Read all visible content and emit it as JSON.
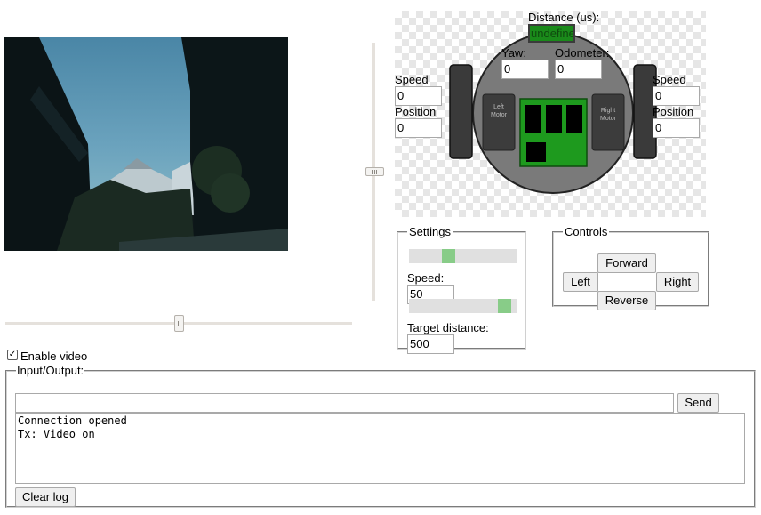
{
  "robot": {
    "distance_label": "Distance (us):",
    "distance_value": "undefine",
    "yaw_label": "Yaw:",
    "yaw_value": "0",
    "odometer_label": "Odometer:",
    "odometer_value": "0",
    "left_speed_label": "Speed",
    "left_speed_value": "0",
    "left_position_label": "Position",
    "left_position_value": "0",
    "right_speed_label": "Speed",
    "right_speed_value": "0",
    "right_position_label": "Position",
    "right_position_value": "0",
    "left_motor_label_line1": "Left",
    "left_motor_label_line2": "Motor",
    "right_motor_label_line1": "Right",
    "right_motor_label_line2": "Motor"
  },
  "settings": {
    "legend": "Settings",
    "speed_label": "Speed:",
    "speed_value": "50",
    "speed_slider_fraction": 0.35,
    "target_label": "Target distance:",
    "target_value": "500",
    "target_slider_fraction": 0.93
  },
  "controls": {
    "legend": "Controls",
    "forward": "Forward",
    "left": "Left",
    "right": "Right",
    "reverse": "Reverse"
  },
  "camera_sliders": {
    "pan_fraction": 0.5,
    "tilt_fraction": 0.5
  },
  "video": {
    "enable_label": "Enable video",
    "enabled": true
  },
  "io": {
    "legend": "Input/Output:",
    "input_value": "",
    "send_label": "Send",
    "log_text": "Connection opened\nTx: Video on",
    "clear_label": "Clear log"
  },
  "colors": {
    "distance_bg": "#1a8a1a",
    "board_green": "#1e9a1e",
    "slider_fill": "#88cc88"
  }
}
